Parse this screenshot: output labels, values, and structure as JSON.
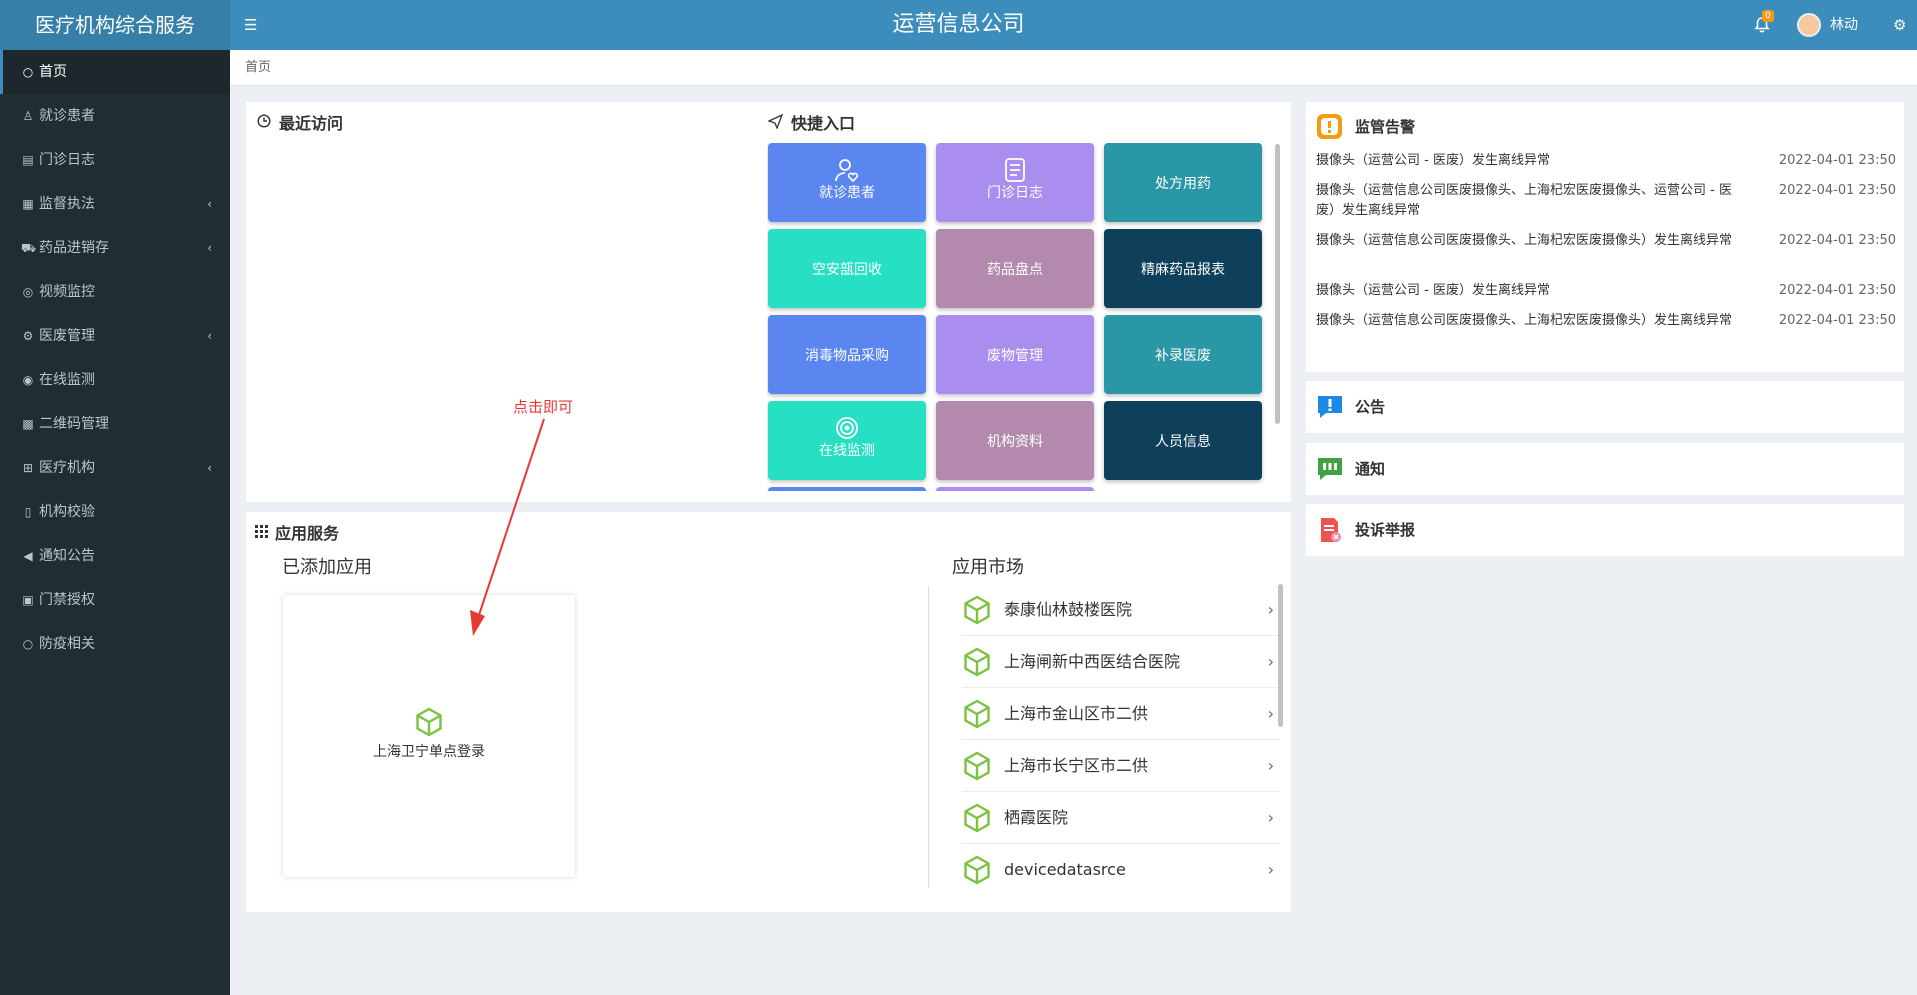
{
  "app": {
    "brand": "医疗机构综合服务",
    "company_title": "运营信息公司",
    "notification_count": "0",
    "username": "林动"
  },
  "colors": {
    "header": "#3c8dbc",
    "sidebar": "#222d32",
    "annotation": "#e53935"
  },
  "sidebar": {
    "items": [
      {
        "label": "首页",
        "icon": "circle-icon",
        "active": true
      },
      {
        "label": "就诊患者",
        "icon": "user-icon"
      },
      {
        "label": "门诊日志",
        "icon": "log-icon"
      },
      {
        "label": "监督执法",
        "icon": "clipboard-icon",
        "has_children": true
      },
      {
        "label": "药品进销存",
        "icon": "truck-icon",
        "has_children": true
      },
      {
        "label": "视频监控",
        "icon": "location-icon"
      },
      {
        "label": "医废管理",
        "icon": "settings-icon",
        "has_children": true
      },
      {
        "label": "在线监测",
        "icon": "target-icon"
      },
      {
        "label": "二维码管理",
        "icon": "qrcode-icon"
      },
      {
        "label": "医疗机构",
        "icon": "hospital-icon",
        "has_children": true
      },
      {
        "label": "机构校验",
        "icon": "file-icon"
      },
      {
        "label": "通知公告",
        "icon": "volume-icon"
      },
      {
        "label": "门禁授权",
        "icon": "briefcase-icon"
      },
      {
        "label": "防疫相关",
        "icon": "circle-icon"
      }
    ]
  },
  "breadcrumb": "首页",
  "recent": {
    "title": "最近访问"
  },
  "quick": {
    "title": "快捷入口",
    "tiles": [
      {
        "label": "就诊患者",
        "color": "#5b86f0",
        "icon": "user-heart-icon"
      },
      {
        "label": "门诊日志",
        "color": "#a98ef0",
        "icon": "log-icon"
      },
      {
        "label": "处方用药",
        "color": "#2a97a6"
      },
      {
        "label": "空安瓿回收",
        "color": "#27e0c4"
      },
      {
        "label": "药品盘点",
        "color": "#b38aae"
      },
      {
        "label": "精麻药品报表",
        "color": "#0e3f5b"
      },
      {
        "label": "消毒物品采购",
        "color": "#5b86f0"
      },
      {
        "label": "废物管理",
        "color": "#a98ef0"
      },
      {
        "label": "补录医废",
        "color": "#2a97a6"
      },
      {
        "label": "在线监测",
        "color": "#27e0c4",
        "icon": "target-icon"
      },
      {
        "label": "机构资料",
        "color": "#b38aae"
      },
      {
        "label": "人员信息",
        "color": "#0e3f5b"
      }
    ]
  },
  "apps": {
    "title": "应用服务",
    "added_title": "已添加应用",
    "added": [
      {
        "label": "上海卫宁单点登录"
      }
    ],
    "market_title": "应用市场",
    "market": [
      {
        "label": "泰康仙林鼓楼医院"
      },
      {
        "label": "上海闸新中西医结合医院"
      },
      {
        "label": "上海市金山区市二供"
      },
      {
        "label": "上海市长宁区市二供"
      },
      {
        "label": "栖霞医院"
      },
      {
        "label": "devicedatasrce"
      }
    ]
  },
  "annotation": "点击即可",
  "alerts": {
    "title": "监管告警",
    "items": [
      {
        "text": "摄像头（运营公司 - 医废）发生离线异常",
        "time": "2022-04-01 23:50"
      },
      {
        "text": "摄像头（运营信息公司医废摄像头、上海杞宏医废摄像头、运营公司 - 医废）发生离线异常",
        "time": "2022-04-01 23:50"
      },
      {
        "text": "摄像头（运营信息公司医废摄像头、上海杞宏医废摄像头）发生离线异常",
        "time": "2022-04-01 23:50"
      },
      {
        "text": "摄像头（运营公司 - 医废）发生离线异常",
        "time": "2022-04-01 23:50"
      },
      {
        "text": "摄像头（运营信息公司医废摄像头、上海杞宏医废摄像头）发生离线异常",
        "time": "2022-04-01 23:50"
      }
    ]
  },
  "cards": {
    "announcement": "公告",
    "notice": "通知",
    "complaint": "投诉举报"
  }
}
